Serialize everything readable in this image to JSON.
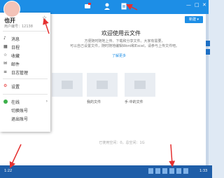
{
  "app": {
    "welcome_title": "欢迎使用云文件",
    "description_lines": [
      "方便随时随地上传、下载和分享文件。大家有需要，",
      "可以自己设置文件，随时随地编辑Word和Excel，请参与上传文件吧。"
    ],
    "learn_more": "了解更多",
    "new_button": "新建 ▾",
    "footer_text": "已使用空间：0，总空间：1G"
  },
  "files": [
    {
      "label": ""
    },
    {
      "label": "我的文件"
    },
    {
      "label": "手·中的文件"
    }
  ],
  "menu": {
    "user_name": "也开",
    "user_sub": "用户编号：12138",
    "items": [
      {
        "label": "消息",
        "icon": "bell-icon"
      },
      {
        "label": "日程",
        "icon": "calendar-icon"
      },
      {
        "label": "收藏",
        "icon": "star-outline-icon"
      },
      {
        "label": "邮件",
        "icon": "mail-icon"
      },
      {
        "label": "日志管理",
        "icon": "log-icon"
      },
      {
        "label": "设置",
        "icon": "settings-icon"
      },
      {
        "label": "在线",
        "icon": "online-status-icon"
      },
      {
        "label": "切换账号",
        "icon": ""
      },
      {
        "label": "退出账号",
        "icon": ""
      }
    ]
  },
  "taskbar": {
    "start_text": "1:22",
    "clock": "1:33"
  },
  "colors": {
    "brand": "#1d8ee6",
    "taskbar": "#1f5ea8",
    "annotation_arrow": "#e53030"
  }
}
